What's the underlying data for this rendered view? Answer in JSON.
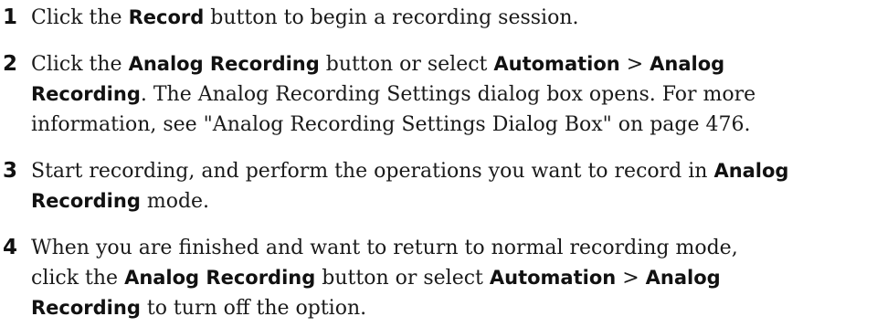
{
  "steps": [
    {
      "number": "1",
      "lines": [
        [
          {
            "t": "Click the ",
            "b": false
          },
          {
            "t": "Record",
            "b": true
          },
          {
            "t": " button to begin a recording session.",
            "b": false
          }
        ]
      ]
    },
    {
      "number": "2",
      "lines": [
        [
          {
            "t": "Click the ",
            "b": false
          },
          {
            "t": "Analog Recording",
            "b": true
          },
          {
            "t": " button or select ",
            "b": false
          },
          {
            "t": "Automation",
            "b": true
          },
          {
            "t": " > ",
            "b": false
          },
          {
            "t": "Analog",
            "b": true
          }
        ],
        [
          {
            "t": "Recording",
            "b": true
          },
          {
            "t": ". The Analog Recording Settings dialog box opens. For more",
            "b": false
          }
        ],
        [
          {
            "t": "information, see \"Analog Recording Settings Dialog Box\" on page 476.",
            "b": false
          }
        ]
      ]
    },
    {
      "number": "3",
      "lines": [
        [
          {
            "t": "Start recording, and perform the operations you want to record in ",
            "b": false
          },
          {
            "t": "Analog",
            "b": true
          }
        ],
        [
          {
            "t": "Recording",
            "b": true
          },
          {
            "t": " mode.",
            "b": false
          }
        ]
      ]
    },
    {
      "number": "4",
      "lines": [
        [
          {
            "t": "When you are finished and want to return to normal recording mode,",
            "b": false
          }
        ],
        [
          {
            "t": "click the ",
            "b": false
          },
          {
            "t": "Analog Recording",
            "b": true
          },
          {
            "t": " button or select ",
            "b": false
          },
          {
            "t": "Automation",
            "b": true
          },
          {
            "t": " > ",
            "b": false
          },
          {
            "t": "Analog",
            "b": true
          }
        ],
        [
          {
            "t": "Recording",
            "b": true
          },
          {
            "t": " to turn off the option.",
            "b": false
          }
        ]
      ]
    }
  ]
}
